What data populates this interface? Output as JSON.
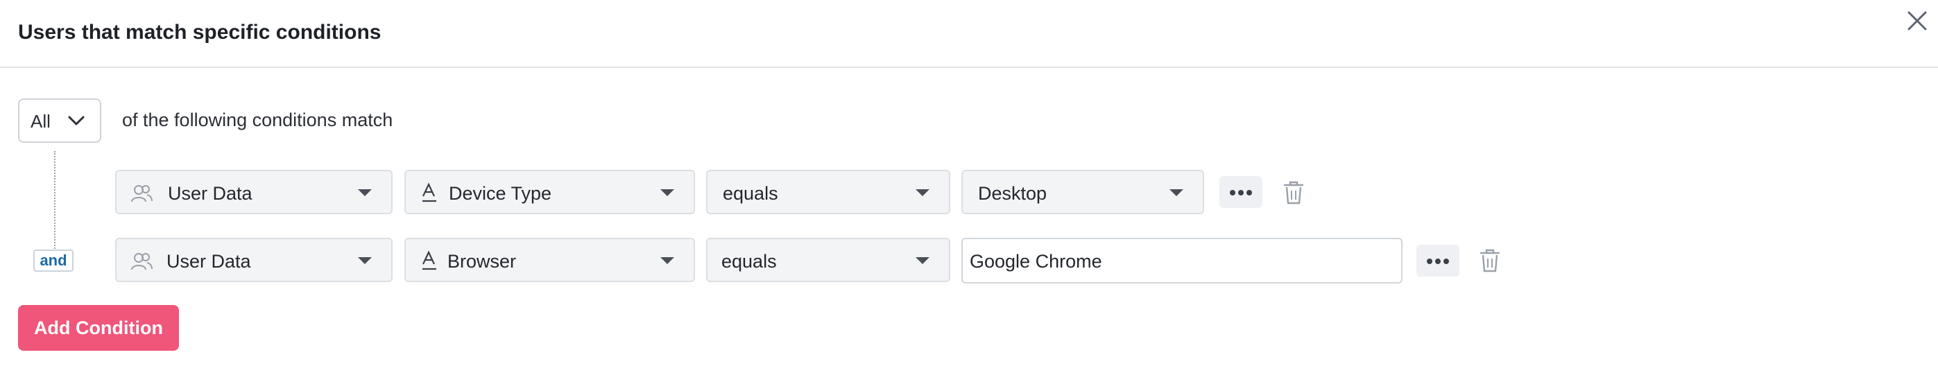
{
  "dialog": {
    "title": "Users that match specific conditions"
  },
  "match": {
    "selected": "All",
    "text": "of the following conditions match"
  },
  "joiner": "and",
  "conditions": [
    {
      "source": "User Data",
      "attribute": "Device Type",
      "operator": "equals",
      "value": "Desktop"
    },
    {
      "source": "User Data",
      "attribute": "Browser",
      "operator": "equals",
      "value": "Google Chrome"
    }
  ],
  "actions": {
    "add_condition": "Add Condition"
  },
  "icons": {
    "close": "close-icon",
    "chevron": "chevron-down-icon",
    "users": "users-icon",
    "text_attribute": "text-attribute-icon",
    "more": "more-icon",
    "trash": "trash-icon"
  },
  "colors": {
    "primary_button": "#f0557a",
    "and_badge_text": "#1b6aa7"
  }
}
